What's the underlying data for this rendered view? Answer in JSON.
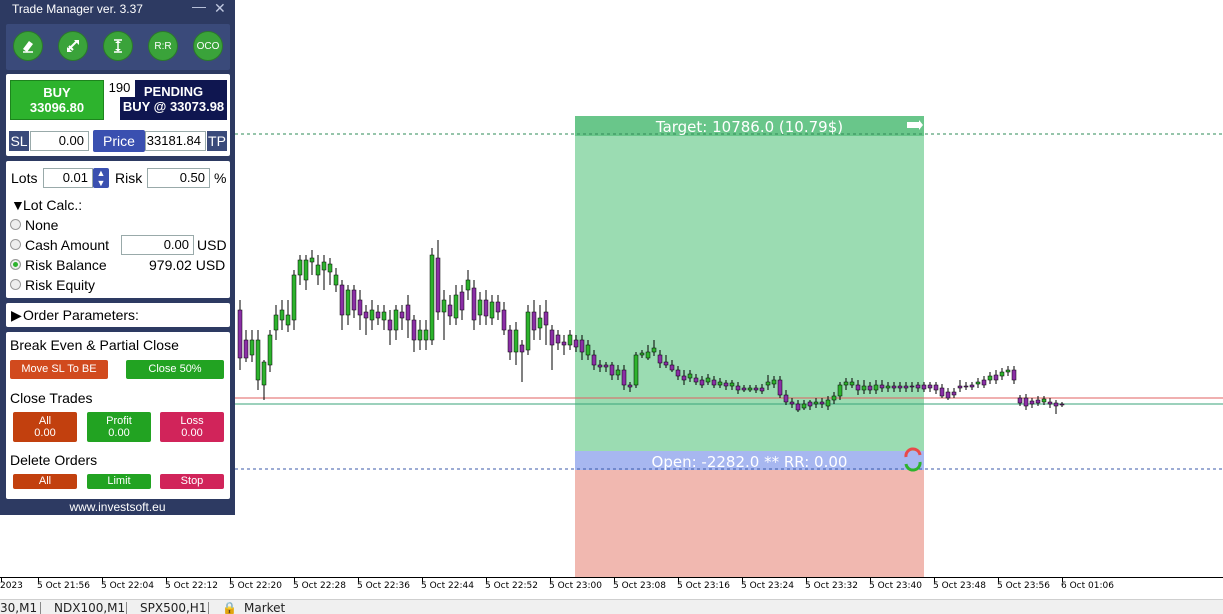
{
  "panel": {
    "title": "Trade Manager ver. 3.37",
    "minimize_icon": "minimize-icon",
    "close_icon": "close-icon",
    "tools": [
      {
        "name": "eraser-icon",
        "label": ""
      },
      {
        "name": "reverse-arrows-icon",
        "label": ""
      },
      {
        "name": "vertical-range-icon",
        "label": ""
      },
      {
        "name": "rr-button",
        "label": "R:R"
      },
      {
        "name": "oco-button",
        "label": "OCO"
      }
    ],
    "buy": {
      "label": "BUY",
      "price": "33096.80"
    },
    "spread": "190",
    "pending": {
      "label": "PENDING",
      "price": "BUY @ 33073.98"
    },
    "sl": {
      "label": "SL",
      "value": "0.00"
    },
    "price": {
      "label": "Price",
      "value": "33181.84"
    },
    "tp": {
      "label": "TP"
    },
    "lots": {
      "label": "Lots",
      "value": "0.01"
    },
    "risk": {
      "label": "Risk",
      "value": "0.50",
      "unit": "%"
    },
    "lot_calc": {
      "label": "Lot Calc.:",
      "options": [
        {
          "label": "None",
          "selected": false
        },
        {
          "label": "Cash Amount",
          "selected": false,
          "value": "0.00",
          "unit": "USD"
        },
        {
          "label": "Risk Balance",
          "selected": true,
          "value": "979.02 USD"
        },
        {
          "label": "Risk Equity",
          "selected": false
        }
      ]
    },
    "order_params": {
      "label": "Order Parameters:"
    },
    "break_even": {
      "label": "Break Even & Partial Close",
      "move_sl_label": "Move SL To BE",
      "close_partial_label": "Close 50%"
    },
    "close_trades": {
      "label": "Close Trades",
      "all": {
        "label": "All",
        "value": "0.00"
      },
      "profit": {
        "label": "Profit",
        "value": "0.00"
      },
      "loss": {
        "label": "Loss",
        "value": "0.00"
      }
    },
    "delete_orders": {
      "label": "Delete Orders",
      "all": "All",
      "limit": "Limit",
      "stop": "Stop"
    },
    "footer": "www.investsoft.eu"
  },
  "chart": {
    "target_text": "Target: 10786.0 (10.79$)",
    "open_text": "Open: -2282.0 ** RR: 0.00",
    "colors": {
      "bull": "#2db32d",
      "bear": "#8b2fa6",
      "target_zone": "#9bdcb2",
      "stop_zone": "#f1b8b0",
      "open_bar": "#a7b7f0",
      "target_bar": "#69c68a",
      "line_red": "#e06060",
      "line_green": "#3aa37a",
      "dashed": "#2e8b57"
    },
    "time_labels": [
      "2023",
      "5 Oct 21:56",
      "5 Oct 22:04",
      "5 Oct 22:12",
      "5 Oct 22:20",
      "5 Oct 22:28",
      "5 Oct 22:36",
      "5 Oct 22:44",
      "5 Oct 22:52",
      "5 Oct 23:00",
      "5 Oct 23:08",
      "5 Oct 23:16",
      "5 Oct 23:24",
      "5 Oct 23:32",
      "5 Oct 23:40",
      "5 Oct 23:48",
      "5 Oct 23:56",
      "6 Oct 01:06"
    ]
  },
  "tabs": [
    {
      "label": "30,M1"
    },
    {
      "label": "NDX100,M1"
    },
    {
      "label": "SPX500,H1"
    },
    {
      "label": "Market"
    }
  ]
}
